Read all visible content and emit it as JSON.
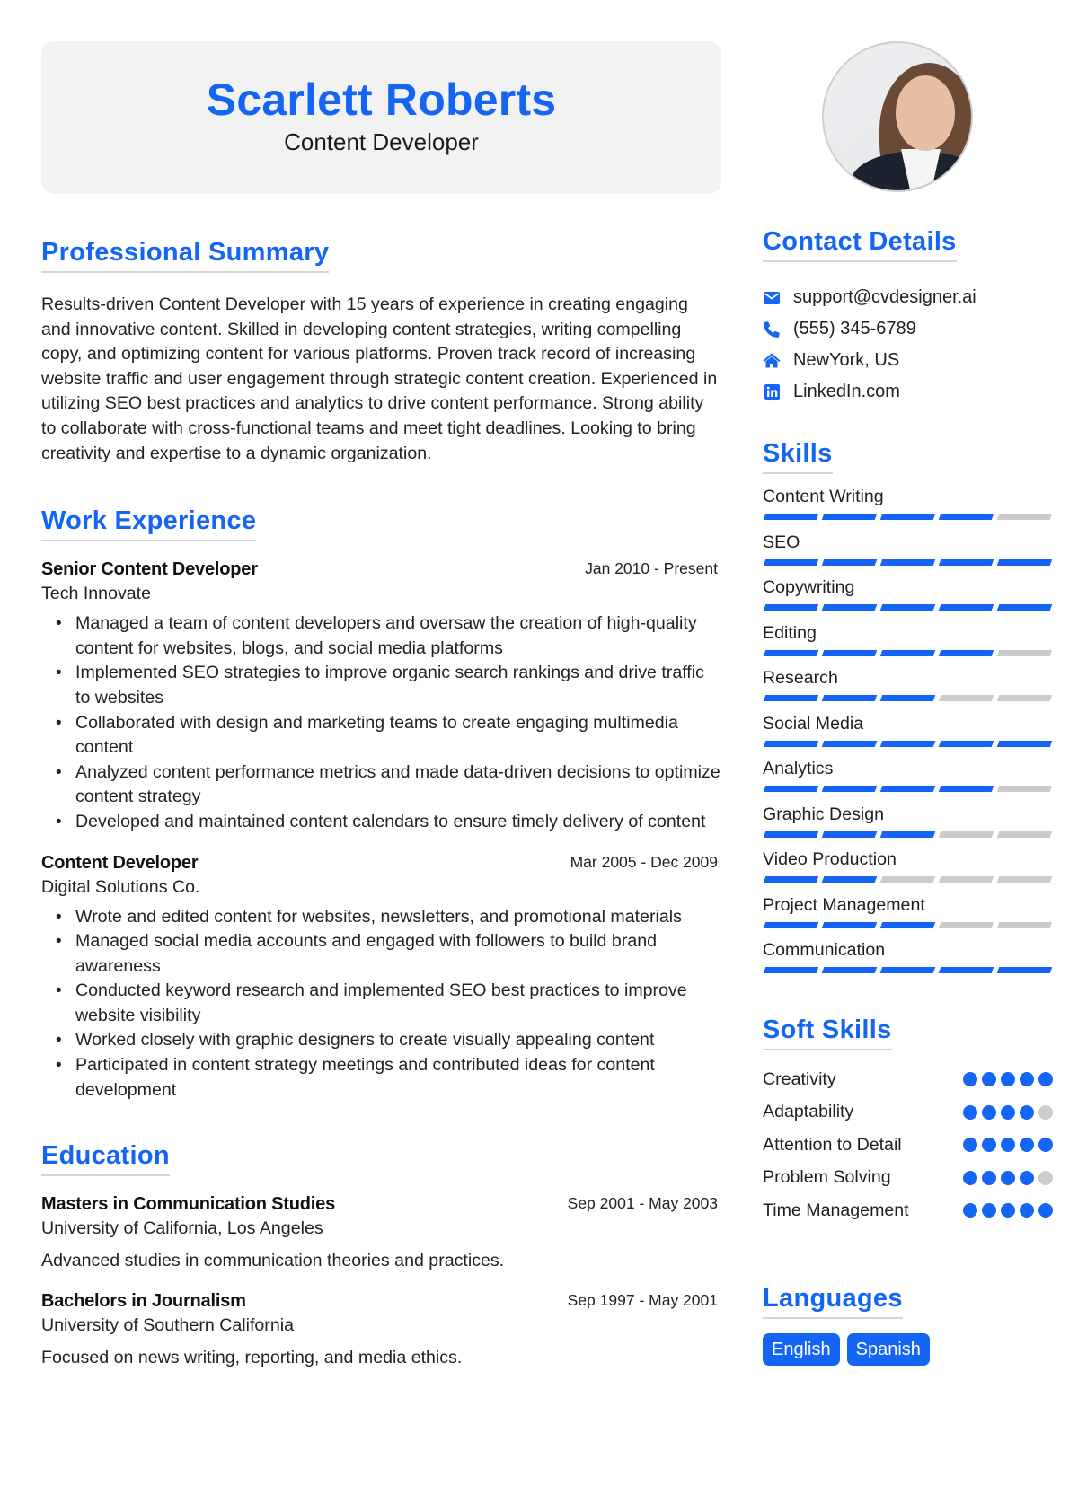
{
  "header": {
    "name": "Scarlett Roberts",
    "title": "Content Developer"
  },
  "summary": {
    "heading": "Professional Summary",
    "text": "Results-driven Content Developer with 15 years of experience in creating engaging and innovative content. Skilled in developing content strategies, writing compelling copy, and optimizing content for various platforms. Proven track record of increasing website traffic and user engagement through strategic content creation. Experienced in utilizing SEO best practices and analytics to drive content performance. Strong ability to collaborate with cross-functional teams and meet tight deadlines. Looking to bring creativity and expertise to a dynamic organization."
  },
  "work": {
    "heading": "Work Experience",
    "jobs": [
      {
        "title": "Senior Content Developer",
        "company": "Tech Innovate",
        "dates": "Jan 2010 - Present",
        "bullets": [
          "Managed a team of content developers and oversaw the creation of high-quality content for websites, blogs, and social media platforms",
          "Implemented SEO strategies to improve organic search rankings and drive traffic to websites",
          "Collaborated with design and marketing teams to create engaging multimedia content",
          "Analyzed content performance metrics and made data-driven decisions to optimize content strategy",
          "Developed and maintained content calendars to ensure timely delivery of content"
        ]
      },
      {
        "title": "Content Developer",
        "company": "Digital Solutions Co.",
        "dates": "Mar 2005 - Dec 2009",
        "bullets": [
          "Wrote and edited content for websites, newsletters, and promotional materials",
          "Managed social media accounts and engaged with followers to build brand awareness",
          "Conducted keyword research and implemented SEO best practices to improve website visibility",
          "Worked closely with graphic designers to create visually appealing content",
          "Participated in content strategy meetings and contributed ideas for content development"
        ]
      }
    ]
  },
  "education": {
    "heading": "Education",
    "items": [
      {
        "degree": "Masters in Communication Studies",
        "school": "University of California, Los Angeles",
        "dates": "Sep 2001 - May 2003",
        "description": "Advanced studies in communication theories and practices."
      },
      {
        "degree": "Bachelors in Journalism",
        "school": "University of Southern California",
        "dates": "Sep 1997 - May 2001",
        "description": "Focused on news writing, reporting, and media ethics."
      }
    ]
  },
  "contact": {
    "heading": "Contact Details",
    "items": [
      {
        "icon": "envelope-icon",
        "text": "support@cvdesigner.ai"
      },
      {
        "icon": "phone-icon",
        "text": "(555) 345-6789"
      },
      {
        "icon": "home-icon",
        "text": "NewYork, US"
      },
      {
        "icon": "linkedin-icon",
        "text": "LinkedIn.com"
      }
    ]
  },
  "skills": {
    "heading": "Skills",
    "max": 5,
    "items": [
      {
        "name": "Content Writing",
        "level": 4
      },
      {
        "name": "SEO",
        "level": 5
      },
      {
        "name": "Copywriting",
        "level": 5
      },
      {
        "name": "Editing",
        "level": 4
      },
      {
        "name": "Research",
        "level": 3
      },
      {
        "name": "Social Media",
        "level": 5
      },
      {
        "name": "Analytics",
        "level": 4
      },
      {
        "name": "Graphic Design",
        "level": 3
      },
      {
        "name": "Video Production",
        "level": 2
      },
      {
        "name": "Project Management",
        "level": 3
      },
      {
        "name": "Communication",
        "level": 5
      }
    ]
  },
  "soft_skills": {
    "heading": "Soft Skills",
    "max": 5,
    "items": [
      {
        "name": "Creativity",
        "level": 5
      },
      {
        "name": "Adaptability",
        "level": 4
      },
      {
        "name": "Attention to Detail",
        "level": 5
      },
      {
        "name": "Problem Solving",
        "level": 4
      },
      {
        "name": "Time Management",
        "level": 5
      }
    ]
  },
  "languages": {
    "heading": "Languages",
    "items": [
      "English",
      "Spanish"
    ]
  },
  "colors": {
    "accent": "#1565f5",
    "inactive": "#cccccc",
    "header_bg": "#f2f2f2"
  }
}
